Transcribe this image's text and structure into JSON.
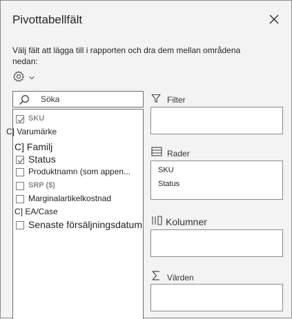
{
  "pane": {
    "title": "Pivottabellfält",
    "instructions": "Välj fält att lägga till i rapporten och dra dem mellan områdena nedan:"
  },
  "search": {
    "value": "Söka"
  },
  "fields": [
    {
      "label": "SKU",
      "checked": true
    },
    {
      "label": "C] Varumärke"
    },
    {
      "label": "C] Familj"
    },
    {
      "label": "Status",
      "checked": true
    },
    {
      "label": "Produktnamn (som appen...",
      "checked": false
    },
    {
      "label": "SRP ($)",
      "checked": false
    },
    {
      "label": "Marginalartikelkostnad",
      "checked": false
    },
    {
      "label": "C] EA/Case"
    },
    {
      "label": "Senaste försäljningsdatum",
      "checked": false
    }
  ],
  "areas": {
    "filter": {
      "label": "Filter",
      "items": []
    },
    "rows": {
      "label": "Rader",
      "items": [
        "SKU",
        "Status"
      ]
    },
    "columns": {
      "label": "Kolumner",
      "items": []
    },
    "values": {
      "label": "Värden",
      "items": []
    }
  }
}
